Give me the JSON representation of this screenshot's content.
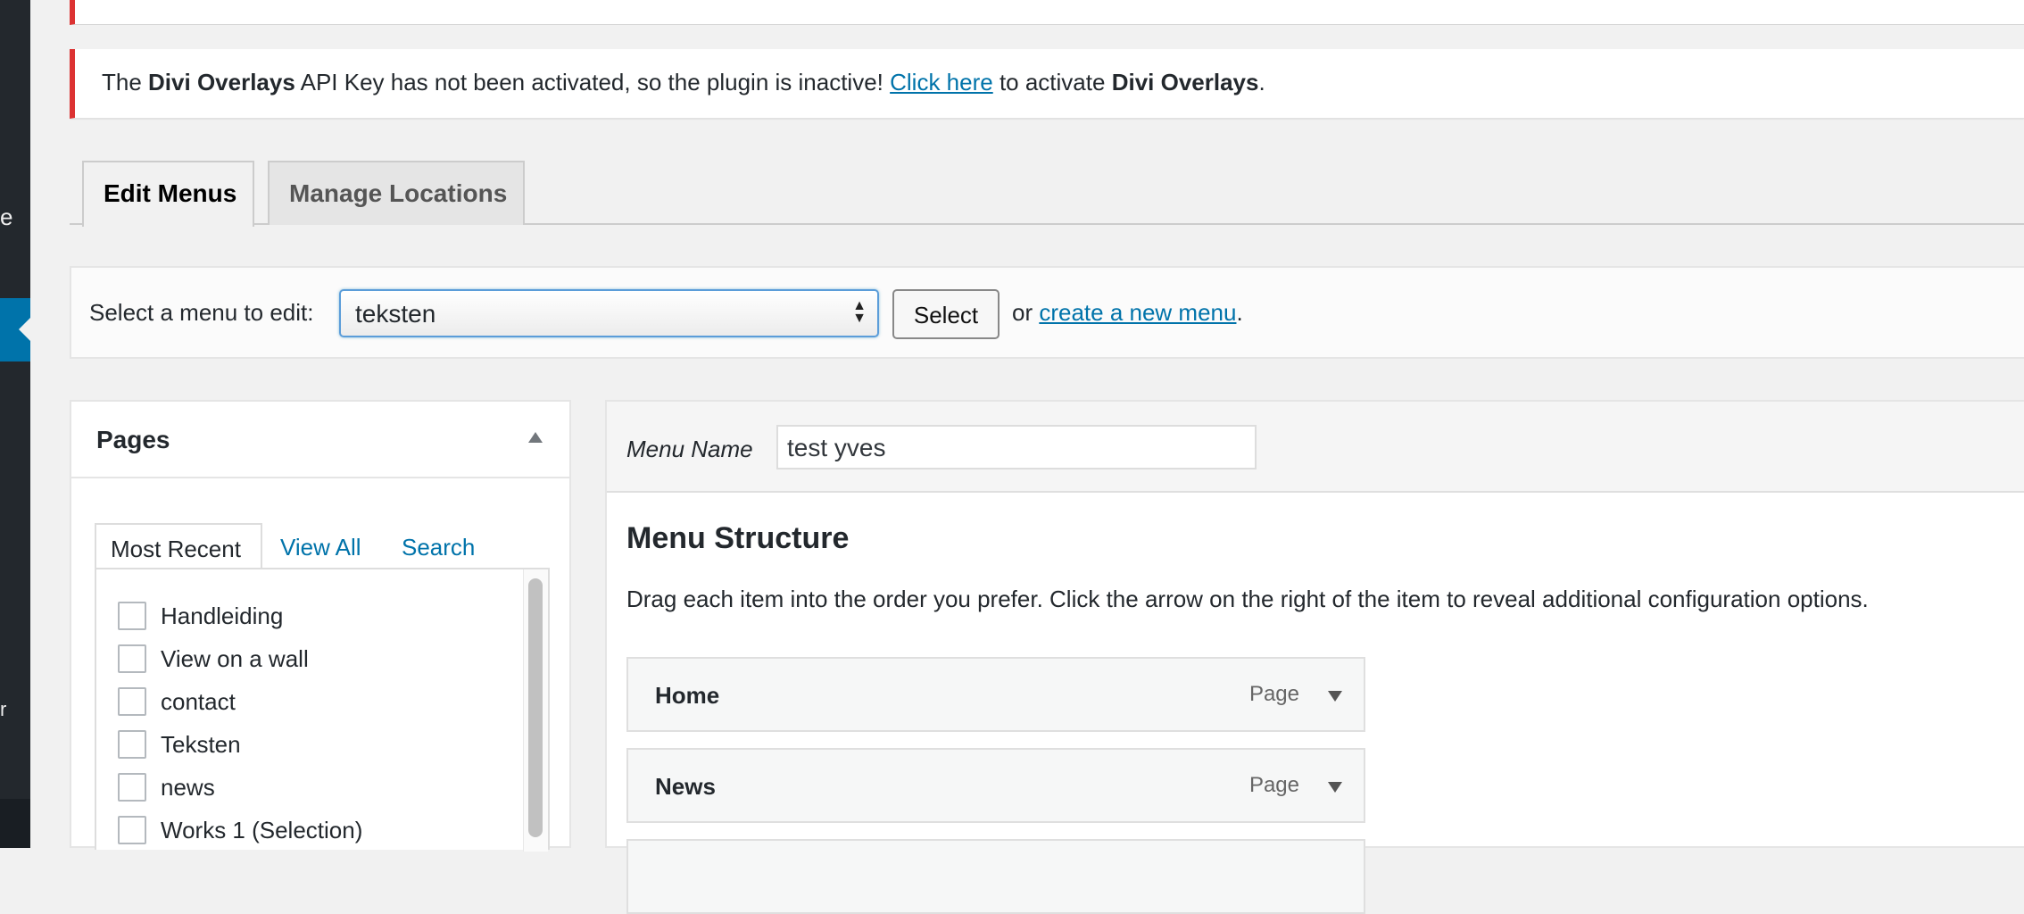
{
  "sidebar": {
    "letter_top": "e",
    "letter_bottom": "r"
  },
  "notice": {
    "prefix": "The ",
    "plugin": "Divi Overlays",
    "middle": " API Key has not been activated, so the plugin is inactive! ",
    "link": "Click here",
    "after_link": " to activate ",
    "plugin2": "Divi Overlays",
    "end": "."
  },
  "tabs": {
    "edit_menus": "Edit Menus",
    "manage_locations": "Manage Locations"
  },
  "manage": {
    "label": "Select a menu to edit:",
    "selected_menu": "teksten",
    "select_button": "Select",
    "or_text": "or ",
    "create_link": "create a new menu",
    "period": "."
  },
  "pages_box": {
    "title": "Pages",
    "subtabs": [
      "Most Recent",
      "View All",
      "Search"
    ],
    "items": [
      "Handleiding",
      "View on a wall",
      "contact",
      "Teksten",
      "news",
      "Works 1 (Selection)"
    ]
  },
  "menu_edit": {
    "name_label": "Menu Name",
    "name_value": "test yves",
    "structure_title": "Menu Structure",
    "structure_desc": "Drag each item into the order you prefer. Click the arrow on the right of the item to reveal additional configuration options.",
    "items": [
      {
        "title": "Home",
        "type": "Page"
      },
      {
        "title": "News",
        "type": "Page"
      }
    ]
  },
  "colors": {
    "error_border": "#dc3232",
    "link": "#0073aa",
    "sidebar": "#23282d",
    "sidebar_active": "#0073aa"
  }
}
